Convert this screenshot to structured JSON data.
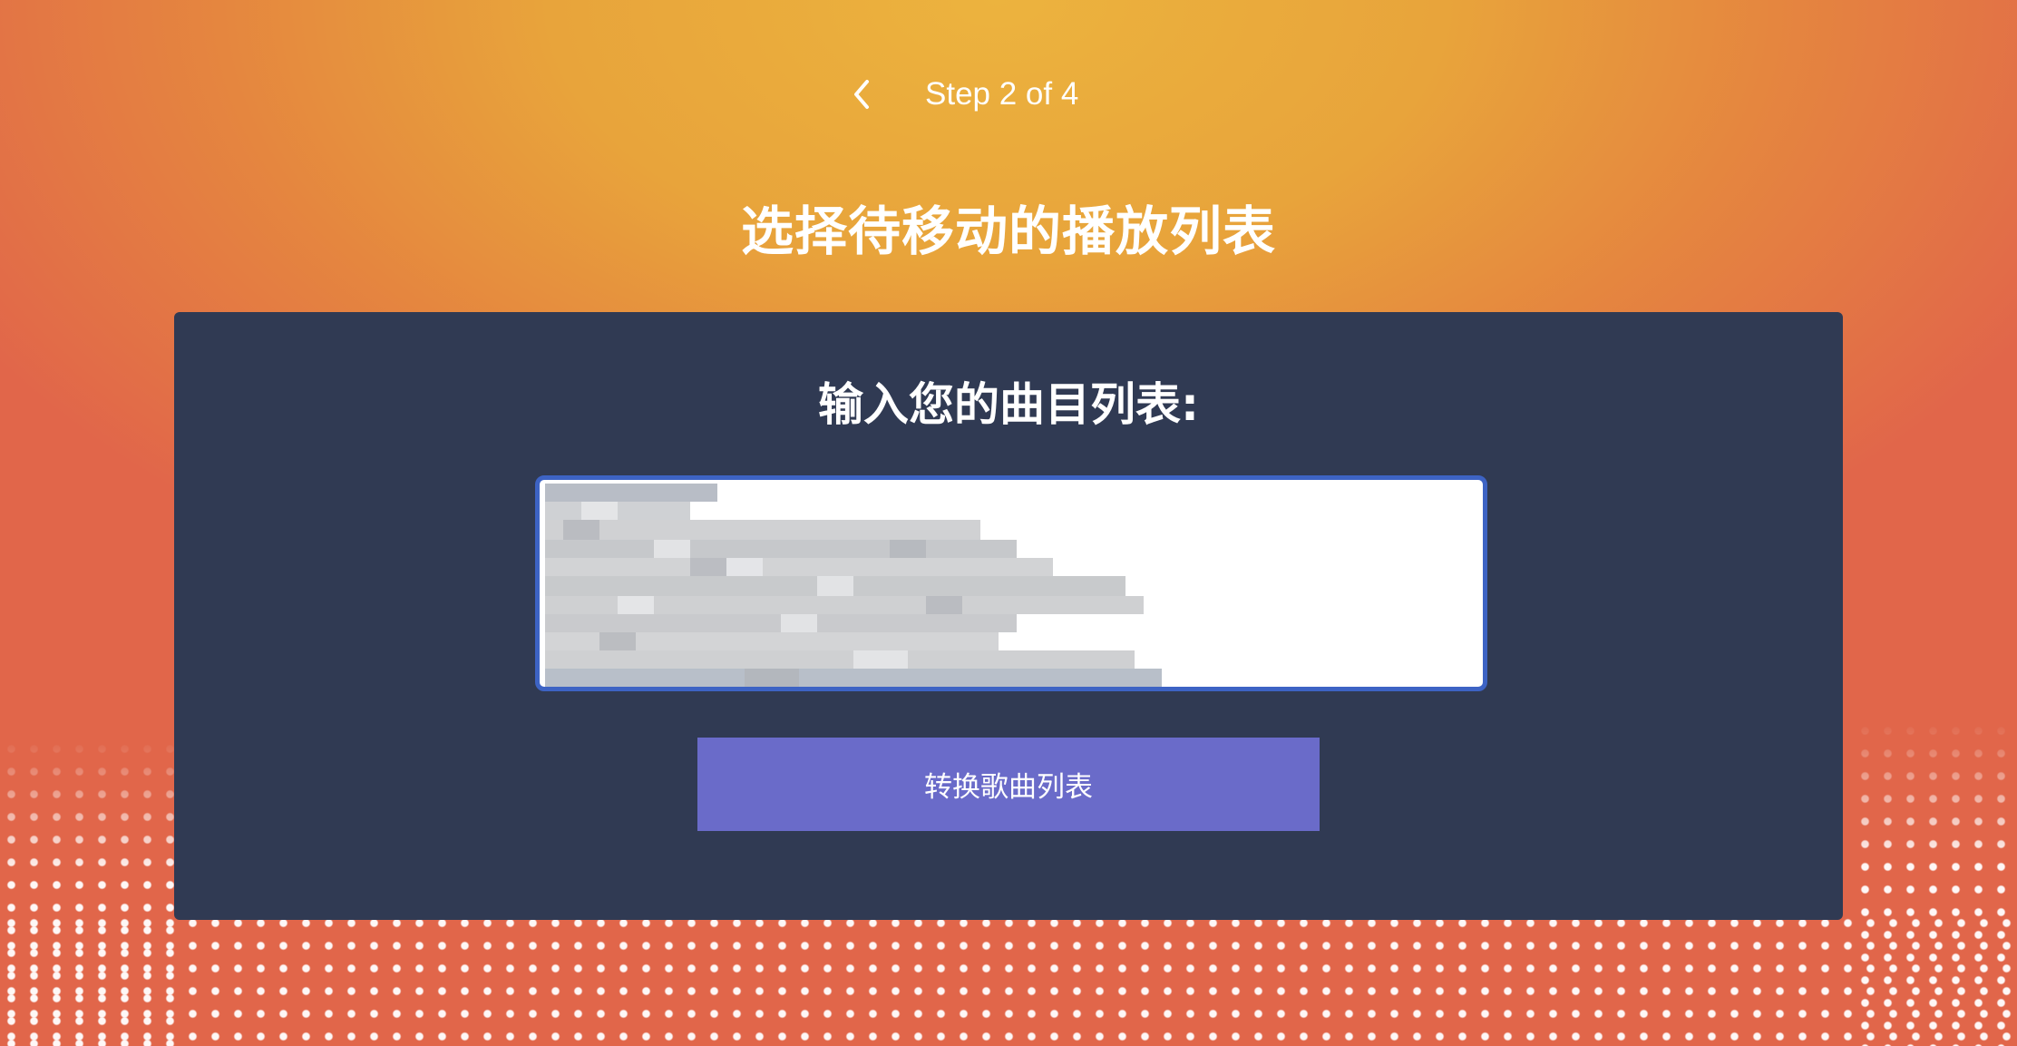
{
  "header": {
    "back_icon": "chevron-left-icon",
    "step_label": "Step 2 of 4"
  },
  "page": {
    "title": "选择待移动的播放列表"
  },
  "card": {
    "heading": "输入您的曲目列表:",
    "track_list": {
      "value": "",
      "state": "content pixelated / redacted in screenshot"
    },
    "convert_button_label": "转换歌曲列表"
  },
  "colors": {
    "background_center": "#ecb33e",
    "background_edge": "#e1664a",
    "card_background": "#303a53",
    "textarea_border": "#3d63c4",
    "button_background": "#6a6bc9",
    "text_light": "#ffffff"
  }
}
